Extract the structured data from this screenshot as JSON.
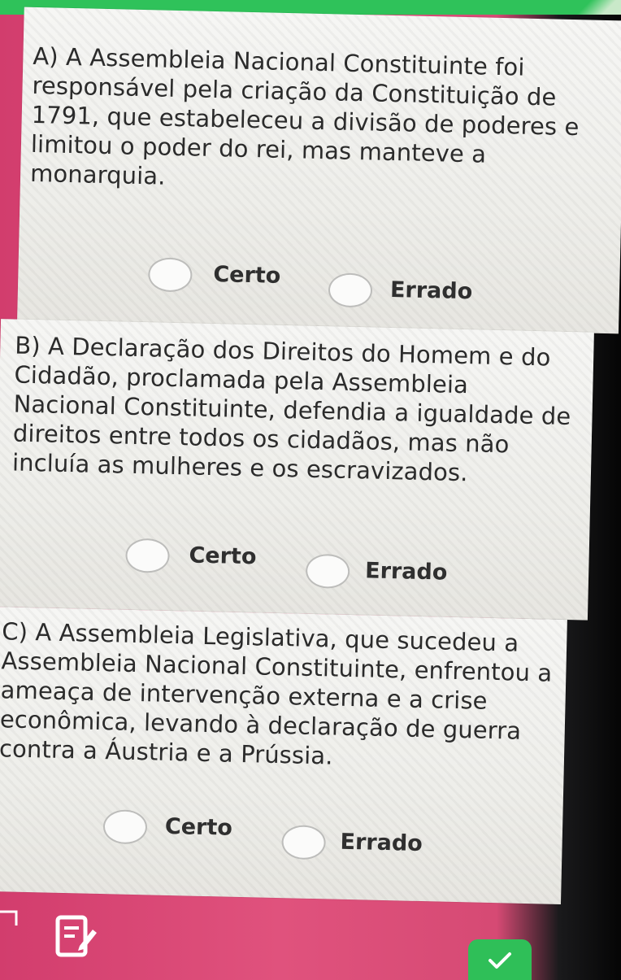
{
  "questions": [
    {
      "lines": [
        "A) A Assembleia Nacional Constituinte foi",
        "responsável pela criação da Constituição de",
        "1791, que estabeleceu a divisão de poderes e",
        "limitou o poder do rei, mas manteve a",
        "monarquia."
      ],
      "option_true": "Certo",
      "option_false": "Errado"
    },
    {
      "lines": [
        "B) A Declaração dos Direitos do Homem e do",
        "Cidadão, proclamada pela Assembleia",
        "Nacional Constituinte, defendia a igualdade de",
        "direitos entre todos os cidadãos, mas não",
        "incluía as mulheres e os escravizados."
      ],
      "option_true": "Certo",
      "option_false": "Errado"
    },
    {
      "lines": [
        "C) A Assembleia Legislativa, que sucedeu a",
        "Assembleia Nacional Constituinte, enfrentou a",
        "ameaça de intervenção externa e a crise",
        "econômica, levando à declaração de guerra",
        "contra a Áustria e a Prússia."
      ],
      "option_true": "Certo",
      "option_false": "Errado"
    }
  ],
  "toolbar": {
    "notes_icon": "edit-notes-icon",
    "check_icon": "check-icon",
    "accent_color": "#2fbf58",
    "background_color": "#e0527d"
  }
}
